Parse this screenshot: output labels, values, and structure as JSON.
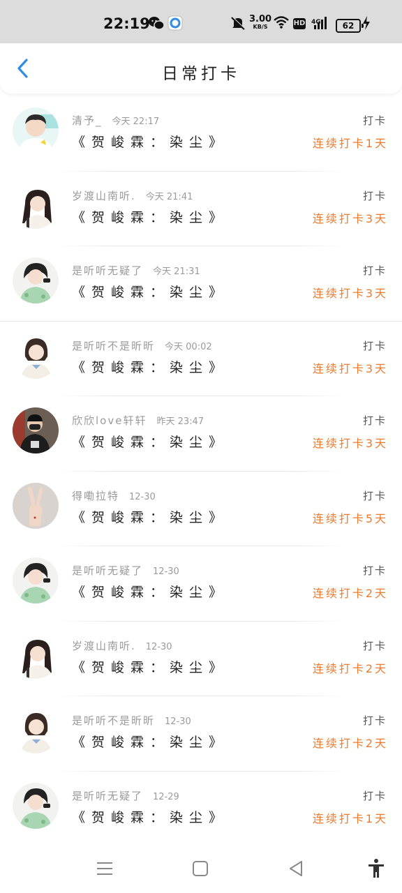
{
  "status_bar": {
    "time": "22:19",
    "net_speed_value": "3.00",
    "net_speed_unit": "KB/S",
    "hd_label": "HD",
    "network_label": "4G",
    "battery_level": "62",
    "icons": [
      "wechat-icon",
      "app-icon",
      "mute-icon",
      "wifi-icon",
      "signal-icon",
      "charging-icon"
    ]
  },
  "header": {
    "title": "日常打卡",
    "back_icon": "chevron-left-icon",
    "accent_color": "#2f8de4"
  },
  "entries": [
    {
      "user": "清予_",
      "time": "今天 22:17",
      "book": "《贺峻霖：染尘》",
      "label": "打卡",
      "streak": "连续打卡1天",
      "avatar": "boy-white-shirt"
    },
    {
      "user": "岁渡山南听.",
      "time": "今天 21:41",
      "book": "《贺峻霖：染尘》",
      "label": "打卡",
      "streak": "连续打卡3天",
      "avatar": "girl-long-hair"
    },
    {
      "user": "是听听无疑了",
      "time": "今天 21:31",
      "book": "《贺峻霖：染尘》",
      "label": "打卡",
      "streak": "连续打卡3天",
      "avatar": "girl-green-dress"
    },
    {
      "user": "是听听不是昕昕",
      "time": "今天 00:02",
      "book": "《贺峻霖：染尘》",
      "label": "打卡",
      "streak": "连续打卡3天",
      "avatar": "girl-short-hair"
    },
    {
      "user": "欣欣love轩轩",
      "time": "昨天 23:47",
      "book": "《贺峻霖：染尘》",
      "label": "打卡",
      "streak": "连续打卡3天",
      "avatar": "boy-mask"
    },
    {
      "user": "得嘞拉特",
      "time": "12-30",
      "book": "《贺峻霖：染尘》",
      "label": "打卡",
      "streak": "连续打卡5天",
      "avatar": "peace-hand"
    },
    {
      "user": "是听听无疑了",
      "time": "12-30",
      "book": "《贺峻霖：染尘》",
      "label": "打卡",
      "streak": "连续打卡2天",
      "avatar": "girl-green-dress"
    },
    {
      "user": "岁渡山南听.",
      "time": "12-30",
      "book": "《贺峻霖：染尘》",
      "label": "打卡",
      "streak": "连续打卡2天",
      "avatar": "girl-long-hair"
    },
    {
      "user": "是听听不是昕昕",
      "time": "12-30",
      "book": "《贺峻霖：染尘》",
      "label": "打卡",
      "streak": "连续打卡2天",
      "avatar": "girl-short-hair"
    },
    {
      "user": "是听听无疑了",
      "time": "12-29",
      "book": "《贺峻霖：染尘》",
      "label": "打卡",
      "streak": "连续打卡1天",
      "avatar": "girl-green-dress"
    }
  ],
  "colors": {
    "streak": "#ef7a2c",
    "username": "#9a9a9a",
    "status_bar_bg": "#dcdcdc"
  },
  "nav_bar": {
    "icons": [
      "menu-icon",
      "home-icon",
      "back-triangle-icon",
      "accessibility-icon"
    ]
  }
}
